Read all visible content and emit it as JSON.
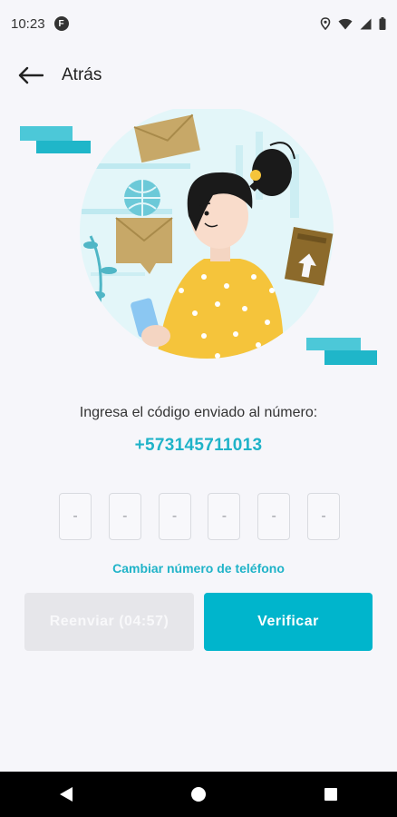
{
  "status_bar": {
    "time": "10:23",
    "badge_letter": "F",
    "icons": [
      "location-icon",
      "wifi-icon",
      "cell-signal-icon",
      "battery-icon"
    ]
  },
  "nav": {
    "back_label": "Atrás",
    "back_icon": "arrow-left-icon"
  },
  "illustration": {
    "description_icon": "woman-with-phone-and-envelopes-illustration",
    "colors": {
      "circle": "#d6f3f8",
      "accent": "#3cc3d6",
      "shirt": "#f5c43b",
      "envelope": "#c7a868",
      "hair": "#1a1a1a"
    }
  },
  "verification": {
    "prompt": "Ingresa el código enviado al número:",
    "phone_number": "+573145711013",
    "code_digits": [
      "-",
      "-",
      "-",
      "-",
      "-",
      "-"
    ],
    "change_number_label": "Cambiar número de teléfono"
  },
  "buttons": {
    "resend_label": "Reenviar (04:57)",
    "verify_label": "Verificar"
  },
  "colors": {
    "accent": "#00b5cc",
    "link": "#1fb3c8",
    "disabled_bg": "#e6e6ea",
    "background": "#f6f6fa"
  },
  "system_nav": {
    "icons": [
      "back-triangle-icon",
      "home-circle-icon",
      "recents-square-icon"
    ]
  }
}
